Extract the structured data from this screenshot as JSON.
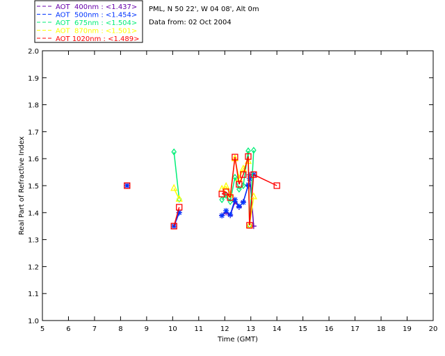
{
  "header": {
    "site": "PML, N 50 22', W 04 08', Alt 0m",
    "date": "Data from: 02 Oct 2004"
  },
  "chart_data": {
    "type": "line",
    "title": "",
    "xlabel": "Time (GMT)",
    "ylabel": "Real Part of Refractive Index",
    "xlim": [
      5,
      20
    ],
    "ylim": [
      1.0,
      2.0
    ],
    "xticks": [
      "5",
      "6",
      "7",
      "8",
      "9",
      "10",
      "11",
      "12",
      "13",
      "14",
      "15",
      "16",
      "17",
      "18",
      "19",
      "20"
    ],
    "yticks": [
      "1.0",
      "1.1",
      "1.2",
      "1.3",
      "1.4",
      "1.5",
      "1.6",
      "1.7",
      "1.8",
      "1.9",
      "2.0"
    ],
    "grid": false,
    "legend": "top-left, outside plot",
    "series": [
      {
        "name": "AOT  400nm : <1.437>",
        "color": "#6600aa",
        "marker": "plus",
        "x": [
          8.25,
          10.05,
          10.25,
          11.89,
          12.05,
          12.21,
          12.39,
          12.55,
          12.71,
          12.9,
          12.95,
          13.11
        ],
        "y": [
          1.5,
          1.35,
          1.4,
          1.39,
          1.4,
          1.39,
          1.44,
          1.42,
          1.44,
          1.5,
          1.54,
          1.35
        ]
      },
      {
        "name": "AOT  500nm : <1.454>",
        "color": "#0033ff",
        "marker": "star",
        "x": [
          8.25,
          10.05,
          10.25,
          11.89,
          12.05,
          12.21,
          12.39,
          12.55,
          12.71,
          12.9,
          12.95,
          13.11
        ],
        "y": [
          1.5,
          1.35,
          1.4,
          1.389,
          1.407,
          1.392,
          1.448,
          1.423,
          1.438,
          1.503,
          1.526,
          1.541
        ]
      },
      {
        "name": "AOT  675nm : <1.504>",
        "color": "#00ee77",
        "marker": "diamond",
        "x": [
          10.05,
          10.25,
          11.89,
          12.05,
          12.21,
          12.39,
          12.55,
          12.71,
          12.9,
          12.95,
          13.11
        ],
        "y": [
          1.625,
          1.45,
          1.448,
          1.464,
          1.441,
          1.531,
          1.487,
          1.5,
          1.629,
          1.353,
          1.631
        ]
      },
      {
        "name": "AOT  870nm : <1.501>",
        "color": "#ffff00",
        "marker": "triangle",
        "x": [
          10.05,
          10.25,
          11.89,
          12.05,
          12.21,
          12.39,
          12.55,
          12.71,
          12.9,
          12.95,
          13.11
        ],
        "y": [
          1.49,
          1.45,
          1.487,
          1.497,
          1.466,
          1.6,
          1.526,
          1.562,
          1.59,
          1.353,
          1.459
        ]
      },
      {
        "name": "AOT 1020nm : <1.489>",
        "color": "#ff0000",
        "marker": "square",
        "x": [
          8.25,
          10.05,
          10.25,
          11.89,
          12.05,
          12.21,
          12.39,
          12.55,
          12.71,
          12.9,
          12.95,
          13.11,
          14.0
        ],
        "y": [
          1.5,
          1.35,
          1.42,
          1.469,
          1.477,
          1.456,
          1.606,
          1.505,
          1.541,
          1.608,
          1.353,
          1.541,
          1.5
        ]
      }
    ],
    "isolated_points": [
      {
        "x": 8.25,
        "y": 1.5
      },
      {
        "x": 14.0,
        "y": 1.5
      }
    ]
  }
}
